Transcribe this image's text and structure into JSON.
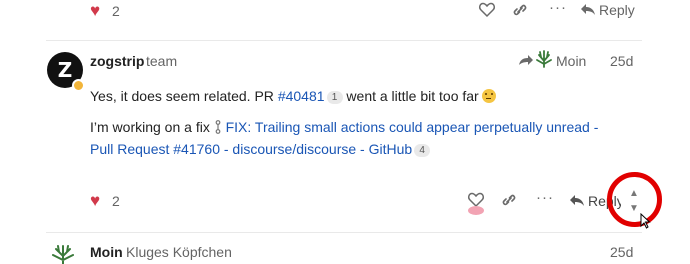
{
  "top_actions": {
    "like_count": "2",
    "reply_label": "Reply"
  },
  "post": {
    "username": "zogstrip",
    "user_title": "team",
    "avatar_letter": "Z",
    "reply_to_user": "Moin",
    "date": "25d",
    "line1_before": "Yes, it does seem related. PR ",
    "pr_link": "#40481",
    "pr_badge": "1",
    "line1_after": " went a little bit too far",
    "line2_before": "I’m working on a fix ",
    "fix_link": "FIX: Trailing small actions could appear perpetually unread - Pull Request #41760 - discourse/discourse - GitHub",
    "fix_badge": "4",
    "like_count": "2",
    "reply_label": "Reply"
  },
  "next_post": {
    "username": "Moin",
    "user_title": "Kluges Köpfchen",
    "date": "25d"
  },
  "colors": {
    "like": "#d1394a",
    "link": "#1a56b5",
    "highlight": "#e10000"
  }
}
